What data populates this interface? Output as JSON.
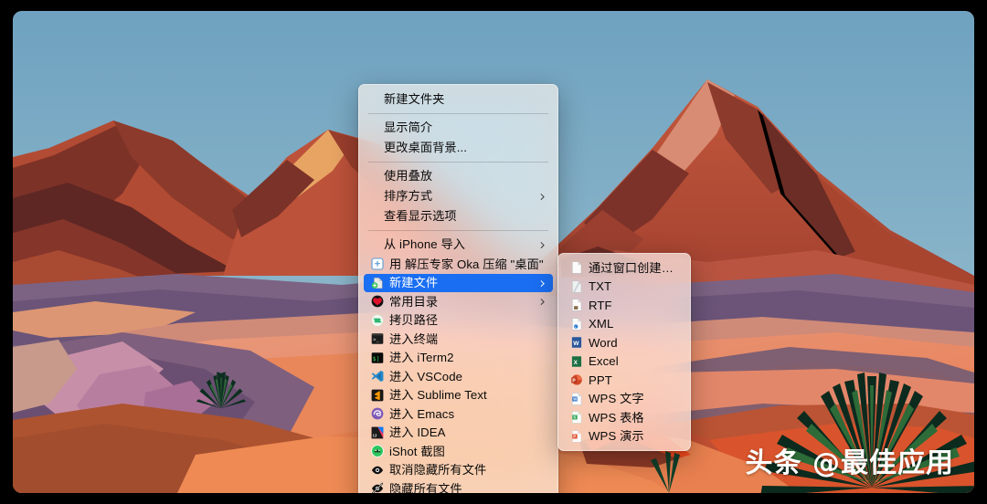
{
  "desktop": {
    "wallpaper_name": "big-sur-desert",
    "sky_color": "#7fa9c4",
    "sand_color": "#e8845c",
    "mountain_color": "#b8452f"
  },
  "context_menu": {
    "name": "desktop-context-menu",
    "groups": [
      {
        "items": [
          {
            "label": "新建文件夹",
            "icon": null,
            "submenu": false,
            "selected": false
          }
        ]
      },
      {
        "items": [
          {
            "label": "显示简介",
            "icon": null,
            "submenu": false,
            "selected": false
          },
          {
            "label": "更改桌面背景...",
            "icon": null,
            "submenu": false,
            "selected": false
          }
        ]
      },
      {
        "items": [
          {
            "label": "使用叠放",
            "icon": null,
            "submenu": false,
            "selected": false
          },
          {
            "label": "排序方式",
            "icon": null,
            "submenu": true,
            "selected": false
          },
          {
            "label": "查看显示选项",
            "icon": null,
            "submenu": false,
            "selected": false
          }
        ]
      },
      {
        "items": [
          {
            "label": "从 iPhone 导入",
            "icon": null,
            "submenu": true,
            "selected": false
          },
          {
            "label": "用 解压专家 Oka 压缩 \"桌面\"",
            "icon": "oka-archive-icon",
            "submenu": false,
            "selected": false
          },
          {
            "label": "新建文件",
            "icon": "new-file-icon",
            "submenu": true,
            "selected": true
          },
          {
            "label": "常用目录",
            "icon": "heart-icon",
            "submenu": true,
            "selected": false
          },
          {
            "label": "拷贝路径",
            "icon": "copy-path-icon",
            "submenu": false,
            "selected": false
          },
          {
            "label": "进入终端",
            "icon": "terminal-icon",
            "submenu": false,
            "selected": false
          },
          {
            "label": "进入 iTerm2",
            "icon": "iterm2-icon",
            "submenu": false,
            "selected": false
          },
          {
            "label": "进入 VSCode",
            "icon": "vscode-icon",
            "submenu": false,
            "selected": false
          },
          {
            "label": "进入 Sublime Text",
            "icon": "sublime-icon",
            "submenu": false,
            "selected": false
          },
          {
            "label": "进入 Emacs",
            "icon": "emacs-icon",
            "submenu": false,
            "selected": false
          },
          {
            "label": "进入 IDEA",
            "icon": "idea-icon",
            "submenu": false,
            "selected": false
          },
          {
            "label": "iShot 截图",
            "icon": "ishot-icon",
            "submenu": false,
            "selected": false
          },
          {
            "label": "取消隐藏所有文件",
            "icon": "eye-icon",
            "submenu": false,
            "selected": false
          },
          {
            "label": "隐藏所有文件",
            "icon": "eye-slash-icon",
            "submenu": false,
            "selected": false
          }
        ]
      }
    ]
  },
  "submenu": {
    "name": "new-file-submenu",
    "parent_label": "新建文件",
    "items": [
      {
        "label": "通过窗口创建新文件",
        "icon": "blank-doc-icon"
      },
      {
        "label": "TXT",
        "icon": "txt-doc-icon"
      },
      {
        "label": "RTF",
        "icon": "rtf-doc-icon"
      },
      {
        "label": "XML",
        "icon": "xml-doc-icon"
      },
      {
        "label": "Word",
        "icon": "word-icon"
      },
      {
        "label": "Excel",
        "icon": "excel-icon"
      },
      {
        "label": "PPT",
        "icon": "powerpoint-icon"
      },
      {
        "label": "WPS 文字",
        "icon": "wps-writer-icon"
      },
      {
        "label": "WPS 表格",
        "icon": "wps-spreadsheet-icon"
      },
      {
        "label": "WPS 演示",
        "icon": "wps-presentation-icon"
      }
    ]
  },
  "watermark": {
    "text": "头条 @最佳应用"
  },
  "colors": {
    "selection_blue": "#1a6ef2",
    "menu_background": "rgba(246,238,232,0.72)",
    "separator": "rgba(0,0,0,0.16)"
  }
}
